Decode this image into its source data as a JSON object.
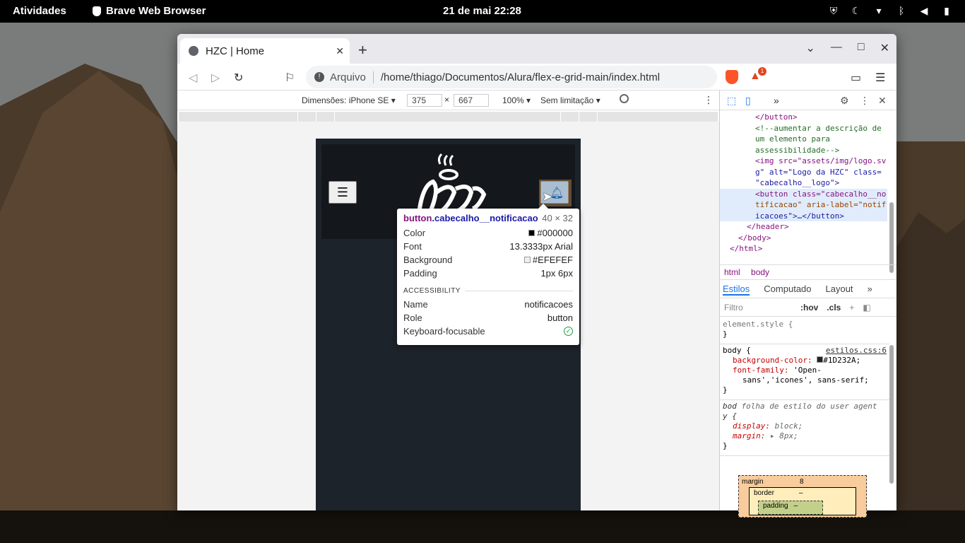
{
  "desktop": {
    "activities": "Atividades",
    "app_name": "Brave Web Browser",
    "clock": "21 de mai  22:28",
    "tray_icons": [
      "shield-icon",
      "moon-icon",
      "wifi-icon",
      "bluetooth-icon",
      "volume-icon",
      "battery-icon"
    ]
  },
  "browser": {
    "tab_title": "HZC | Home",
    "url_label": "Arquivo",
    "url": "/home/thiago/Documentos/Alura/flex-e-grid-main/index.html",
    "rewards_badge": "1"
  },
  "device_toolbar": {
    "dimensions_label": "Dimensões: iPhone SE",
    "width": "375",
    "height": "667",
    "times": "×",
    "zoom": "100%",
    "throttling": "Sem limitação"
  },
  "tooltip": {
    "tag": "button",
    "class": ".cabecalho__notificacao",
    "size": "40 × 32",
    "rows": [
      {
        "key": "Color",
        "value": "#000000",
        "swatch": "#000000"
      },
      {
        "key": "Font",
        "value": "13.3333px Arial"
      },
      {
        "key": "Background",
        "value": "#EFEFEF",
        "swatch": "#EFEFEF"
      },
      {
        "key": "Padding",
        "value": "1px 6px"
      }
    ],
    "accessibility_title": "ACCESSIBILITY",
    "acc_rows": [
      {
        "key": "Name",
        "value": "notificacoes"
      },
      {
        "key": "Role",
        "value": "button"
      },
      {
        "key": "Keyboard-focusable",
        "value": ""
      }
    ]
  },
  "devtools": {
    "elements_lines": [
      "</button>",
      "<!--aumentar a descrição de",
      "um elemento para",
      "assessibilidade-->",
      "<img src=\"assets/img/logo.sv",
      "g\" alt=\"Logo da HZC\" class=",
      "\"cabecalho__logo\">",
      "<button class=\"cabecalho__no",
      "tificacao\" aria-label=\"notif",
      "icacoes\">…</button>",
      "</header>",
      "</body>",
      "</html>"
    ],
    "crumbs": [
      "html",
      "body"
    ],
    "style_tabs": [
      "Estilos",
      "Computado",
      "Layout"
    ],
    "filter_placeholder": "Filtro",
    "hov": ":hov",
    "cls": ".cls",
    "element_style": "element.style {",
    "body_rule_selector": "body {",
    "body_rule_source": "estilos.css:6",
    "body_bg_prop": "background-color:",
    "body_bg_value": "#1D232A;",
    "body_font_prop": "font-family:",
    "body_font_value1": "'Open-",
    "body_font_value2": "sans','icones', sans-serif;",
    "ua_selector": "bod",
    "ua_selector2": "y {",
    "ua_label": "folha de estilo do user agent",
    "ua_display_prop": "display:",
    "ua_display_value": "block;",
    "ua_margin_prop": "margin:",
    "ua_margin_value": "8px;",
    "close_brace": "}",
    "box_margin_label": "margin",
    "box_margin_value": "8",
    "box_border_label": "border",
    "box_border_value": "–",
    "box_padding_label": "padding",
    "box_padding_value": "–"
  }
}
